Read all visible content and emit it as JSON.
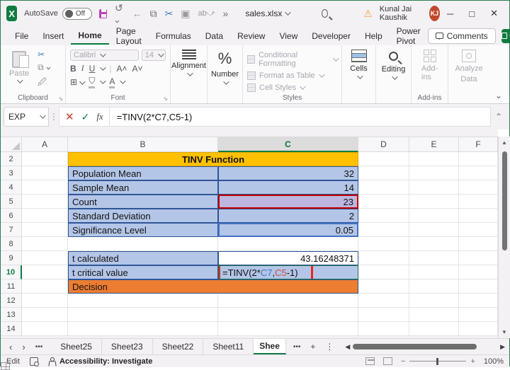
{
  "colors": {
    "excel_green": "#107C41",
    "cell_fill_blue": "#B4C6E7",
    "table_border_blue": "#2F5597",
    "title_fill_orange": "#FFC000",
    "decision_fill_orange": "#ED7D31",
    "annotation_red": "#E8261F",
    "ref_c7_blue": "#4472C4",
    "ref_c5_red": "#C0504D",
    "avatar_bg": "#C0492C"
  },
  "title_bar": {
    "autosave_label": "AutoSave",
    "autosave_state": "Off",
    "file_name": "sales.xlsx",
    "user_name": "Kunal Jai Kaushik",
    "user_initials": "KJ",
    "more_commands": "»",
    "minimize": "─",
    "maximize": "□",
    "close": "✕"
  },
  "menu": {
    "items": [
      "File",
      "Insert",
      "Home",
      "Page Layout",
      "Formulas",
      "Data",
      "Review",
      "View",
      "Developer",
      "Help",
      "Power Pivot"
    ],
    "active": "Home",
    "comments_label": "Comments"
  },
  "ribbon": {
    "paste_label": "Paste",
    "clipboard_group": "Clipboard",
    "font_name": "Calibri",
    "font_size": "14",
    "bold": "B",
    "italic": "I",
    "underline": "U",
    "font_group": "Font",
    "alignment_label": "Alignment",
    "number_label": "Number",
    "styles": {
      "conditional": "Conditional Formatting",
      "format_table": "Format as Table",
      "cell_styles": "Cell Styles",
      "group": "Styles"
    },
    "cells_label": "Cells",
    "editing_label": "Editing",
    "addins_label": "Add-ins",
    "addins_group": "Add-ins",
    "analyze_line1": "Analyze",
    "analyze_line2": "Data"
  },
  "formula_bar": {
    "name_box": "EXP",
    "formula": "=TINV(2*C7,C5-1)",
    "fx": "fx"
  },
  "grid": {
    "columns": [
      "A",
      "B",
      "C",
      "D",
      "E",
      "F"
    ],
    "row_nums": [
      "2",
      "3",
      "4",
      "5",
      "6",
      "7",
      "8",
      "9",
      "10",
      "11",
      "12",
      "13",
      "14"
    ],
    "title_cell": "TINV Function",
    "rows": {
      "population_mean": {
        "label": "Population Mean",
        "value": "32"
      },
      "sample_mean": {
        "label": "Sample Mean",
        "value": "14"
      },
      "count": {
        "label": "Count",
        "value": "23"
      },
      "std_dev": {
        "label": "Standard Deviation",
        "value": "2"
      },
      "significance": {
        "label": "Significance Level",
        "value": "0.05"
      },
      "t_calculated": {
        "label": "t calculated",
        "value": "43.16248371"
      },
      "t_critical": {
        "label": "t critical value"
      },
      "decision": {
        "label": "Decision"
      }
    },
    "formula_parts": {
      "p1": "=TINV(2*",
      "p2": "C7",
      "p3": ",",
      "p4": "C5",
      "p5": "-1)"
    }
  },
  "sheet_tabs": {
    "tabs": [
      "Sheet25",
      "Sheet23",
      "Sheet22",
      "Sheet11"
    ],
    "active": "Shee",
    "new_sheet": "+"
  },
  "status_bar": {
    "mode": "Edit",
    "accessibility": "Accessibility: Investigate",
    "zoom_level": "100%"
  }
}
